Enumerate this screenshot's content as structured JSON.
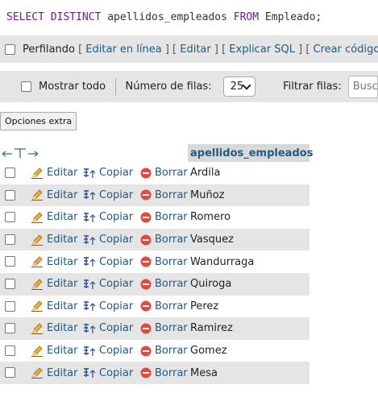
{
  "sql": {
    "keyword1": "SELECT DISTINCT",
    "columns": "apellidos_empleados",
    "keyword2": "FROM",
    "table": "Empleado;"
  },
  "linkbar": {
    "profiling": "Perfilando",
    "links": [
      "Editar en línea",
      "Editar",
      "Explicar SQL",
      "Crear código PHP"
    ]
  },
  "toolbar": {
    "show_all": "Mostrar todo",
    "rows_label": "Número de filas:",
    "rows_value": "25",
    "filter_label": "Filtrar filas:",
    "search_placeholder": "Buscar e"
  },
  "extra_options": "Opciones extra",
  "table": {
    "column": "apellidos_empleados",
    "actions": {
      "edit": "Editar",
      "copy": "Copiar",
      "delete": "Borrar"
    },
    "rows": [
      "Ardila",
      "Muñoz",
      "Romero",
      "Vasquez",
      "Wandurraga",
      "Quiroga",
      "Perez",
      "Ramirez",
      "Gomez",
      "Mesa"
    ]
  },
  "colors": {
    "link": "#235a81",
    "keyword": "#6f17a5",
    "row_alt": "#e5e5e5",
    "delete_icon": "#e34a3c",
    "edit_icon": "#e8b23a"
  }
}
